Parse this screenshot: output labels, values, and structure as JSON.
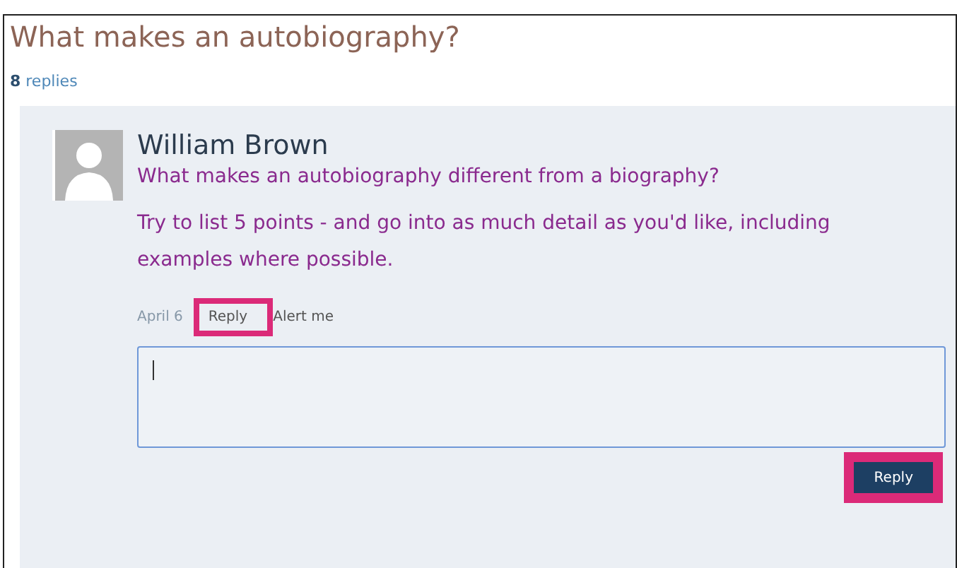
{
  "thread": {
    "title": "What makes an autobiography?",
    "reply_count": "8",
    "reply_label": "replies"
  },
  "post": {
    "author": "William Brown",
    "question": "What makes an autobiography different from a biography?",
    "body": "Try to list 5 points - and go into as much detail as you'd like, including examples where possible.",
    "date": "April 6",
    "actions": [
      {
        "label": "Reply",
        "highlighted": true
      },
      {
        "label": "Alert me",
        "highlighted": false
      }
    ]
  },
  "composer": {
    "focused": true,
    "submit": {
      "label": "Reply",
      "highlighted": true
    }
  }
}
